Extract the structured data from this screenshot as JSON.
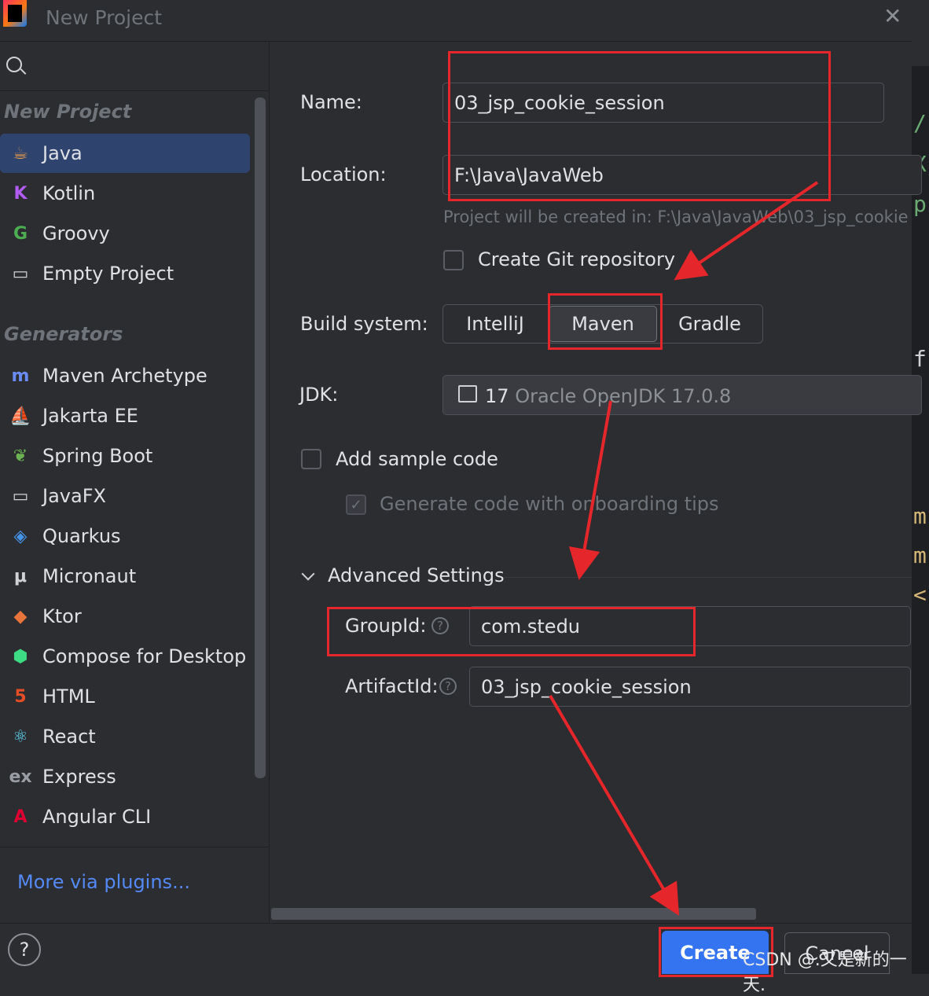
{
  "window": {
    "title": "New Project"
  },
  "sidebar": {
    "section_new": "New Project",
    "new_items": [
      {
        "label": "Java",
        "icon": "java-cup-icon",
        "color": "#e19a4e",
        "glyph": "☕"
      },
      {
        "label": "Kotlin",
        "icon": "kotlin-icon",
        "color": "#b25cf4",
        "glyph": "K"
      },
      {
        "label": "Groovy",
        "icon": "groovy-icon",
        "color": "#4cae50",
        "glyph": "G"
      },
      {
        "label": "Empty Project",
        "icon": "empty-project-icon",
        "color": "#cfd1d5",
        "glyph": "▭"
      }
    ],
    "section_generators": "Generators",
    "generator_items": [
      {
        "label": "Maven Archetype",
        "icon": "maven-icon",
        "color": "#6a8bf5",
        "glyph": "m"
      },
      {
        "label": "Jakarta EE",
        "icon": "jakarta-ee-icon",
        "color": "#f0b43c",
        "glyph": "⛵"
      },
      {
        "label": "Spring Boot",
        "icon": "spring-boot-icon",
        "color": "#6cb452",
        "glyph": "❦"
      },
      {
        "label": "JavaFX",
        "icon": "javafx-icon",
        "color": "#cfd1d5",
        "glyph": "▭"
      },
      {
        "label": "Quarkus",
        "icon": "quarkus-icon",
        "color": "#4695eb",
        "glyph": "◈"
      },
      {
        "label": "Micronaut",
        "icon": "micronaut-icon",
        "color": "#cfd1d5",
        "glyph": "μ"
      },
      {
        "label": "Ktor",
        "icon": "ktor-icon",
        "color": "#e8763b",
        "glyph": "◆"
      },
      {
        "label": "Compose for Desktop",
        "icon": "compose-icon",
        "color": "#3ddc84",
        "glyph": "⬢"
      },
      {
        "label": "HTML",
        "icon": "html5-icon",
        "color": "#e44d26",
        "glyph": "5"
      },
      {
        "label": "React",
        "icon": "react-icon",
        "color": "#61dafb",
        "glyph": "⚛"
      },
      {
        "label": "Express",
        "icon": "express-icon",
        "color": "#9a9da3",
        "glyph": "ex"
      },
      {
        "label": "Angular CLI",
        "icon": "angular-icon",
        "color": "#dd0031",
        "glyph": "A"
      }
    ],
    "more_plugins": "More via plugins..."
  },
  "form": {
    "name_label": "Name:",
    "name_value": "03_jsp_cookie_session",
    "location_label": "Location:",
    "location_value": "F:\\Java\\JavaWeb",
    "location_hint": "Project will be created in: F:\\Java\\JavaWeb\\03_jsp_cookie",
    "git_label": "Create Git repository",
    "build_label": "Build system:",
    "build_options": [
      "IntelliJ",
      "Maven",
      "Gradle"
    ],
    "build_selected": "Maven",
    "jdk_label": "JDK:",
    "jdk_version": "17",
    "jdk_name": "Oracle OpenJDK 17.0.8",
    "sample_code_label": "Add sample code",
    "onboarding_label": "Generate code with onboarding tips",
    "advanced_label": "Advanced Settings",
    "groupid_label": "GroupId:",
    "groupid_value": "com.stedu",
    "artifactid_label": "ArtifactId:",
    "artifactid_value": "03_jsp_cookie_session"
  },
  "buttons": {
    "create": "Create",
    "cancel": "Cancel",
    "help": "?"
  },
  "editor_fragments": [
    "/",
    "X",
    "p",
    "f",
    "m",
    "m",
    "<"
  ],
  "watermark": "CSDN @.又是新的一天.",
  "colors": {
    "accent": "#3574f0",
    "selection": "#2e436e",
    "annotation_red": "#e5262b",
    "link": "#548af7"
  }
}
